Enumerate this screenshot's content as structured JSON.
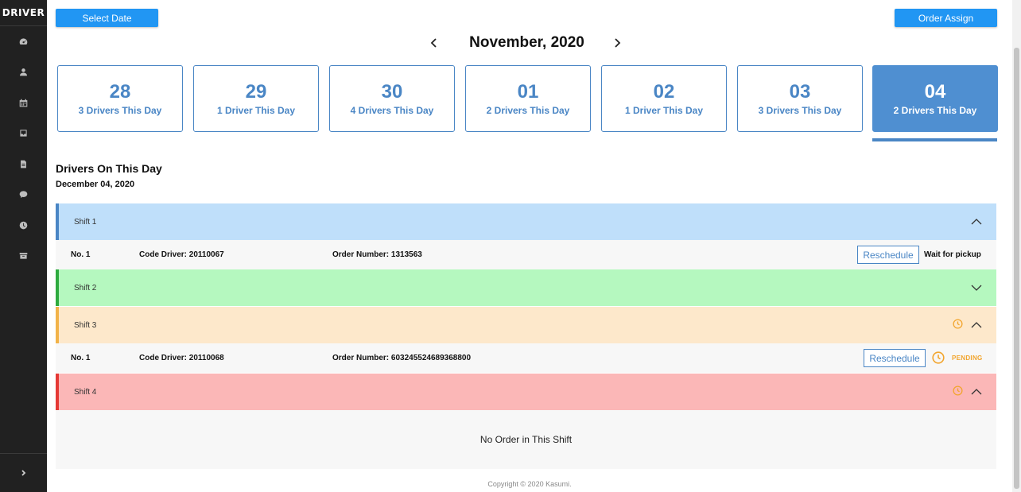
{
  "sidebar": {
    "brand": "DRIVER",
    "items": [
      {
        "icon": "dashboard-icon"
      },
      {
        "icon": "user-icon"
      },
      {
        "icon": "calendar-icon"
      },
      {
        "icon": "inbox-icon"
      },
      {
        "icon": "document-icon"
      },
      {
        "icon": "chat-icon"
      },
      {
        "icon": "clock-icon"
      },
      {
        "icon": "archive-icon"
      }
    ]
  },
  "toolbar": {
    "select_date_label": "Select Date",
    "order_assign_label": "Order Assign"
  },
  "calendar": {
    "month_label": "November, 2020",
    "days": [
      {
        "num": "28",
        "sub": "3 Drivers This Day",
        "active": false
      },
      {
        "num": "29",
        "sub": "1 Driver This Day",
        "active": false
      },
      {
        "num": "30",
        "sub": "4 Drivers This Day",
        "active": false
      },
      {
        "num": "01",
        "sub": "2 Drivers This Day",
        "active": false
      },
      {
        "num": "02",
        "sub": "1 Driver This Day",
        "active": false
      },
      {
        "num": "03",
        "sub": "3 Drivers This Day",
        "active": false
      },
      {
        "num": "04",
        "sub": "2 Drivers This Day",
        "active": true
      }
    ]
  },
  "drivers": {
    "title": "Drivers On This Day",
    "date": "December 04, 2020"
  },
  "shifts": [
    {
      "label": "Shift 1",
      "expanded": true
    },
    {
      "label": "Shift 2",
      "expanded": false
    },
    {
      "label": "Shift 3",
      "expanded": true
    },
    {
      "label": "Shift 4",
      "expanded": true
    }
  ],
  "orders": [
    {
      "no": "No. 1",
      "code_driver": "Code Driver: 20110067",
      "order_number": "Order Number: 1313563",
      "button": "Reschedule",
      "status": "Wait for pickup"
    },
    {
      "no": "No. 1",
      "code_driver": "Code Driver: 20110068",
      "order_number": "Order Number: 603245524689368800",
      "button": "Reschedule",
      "status": "PENDING"
    }
  ],
  "empty_shift_text": "No Order in This Shift",
  "footer": "Copyright © 2020 Kasumi.",
  "colors": {
    "accent": "#4a86c5",
    "button_blue": "#2196f3",
    "shift_1": "#bfdffa",
    "shift_2": "#b5f8bf",
    "shift_3": "#fde8cb",
    "shift_4": "#fbb7b7",
    "pending": "#f2a52e"
  }
}
